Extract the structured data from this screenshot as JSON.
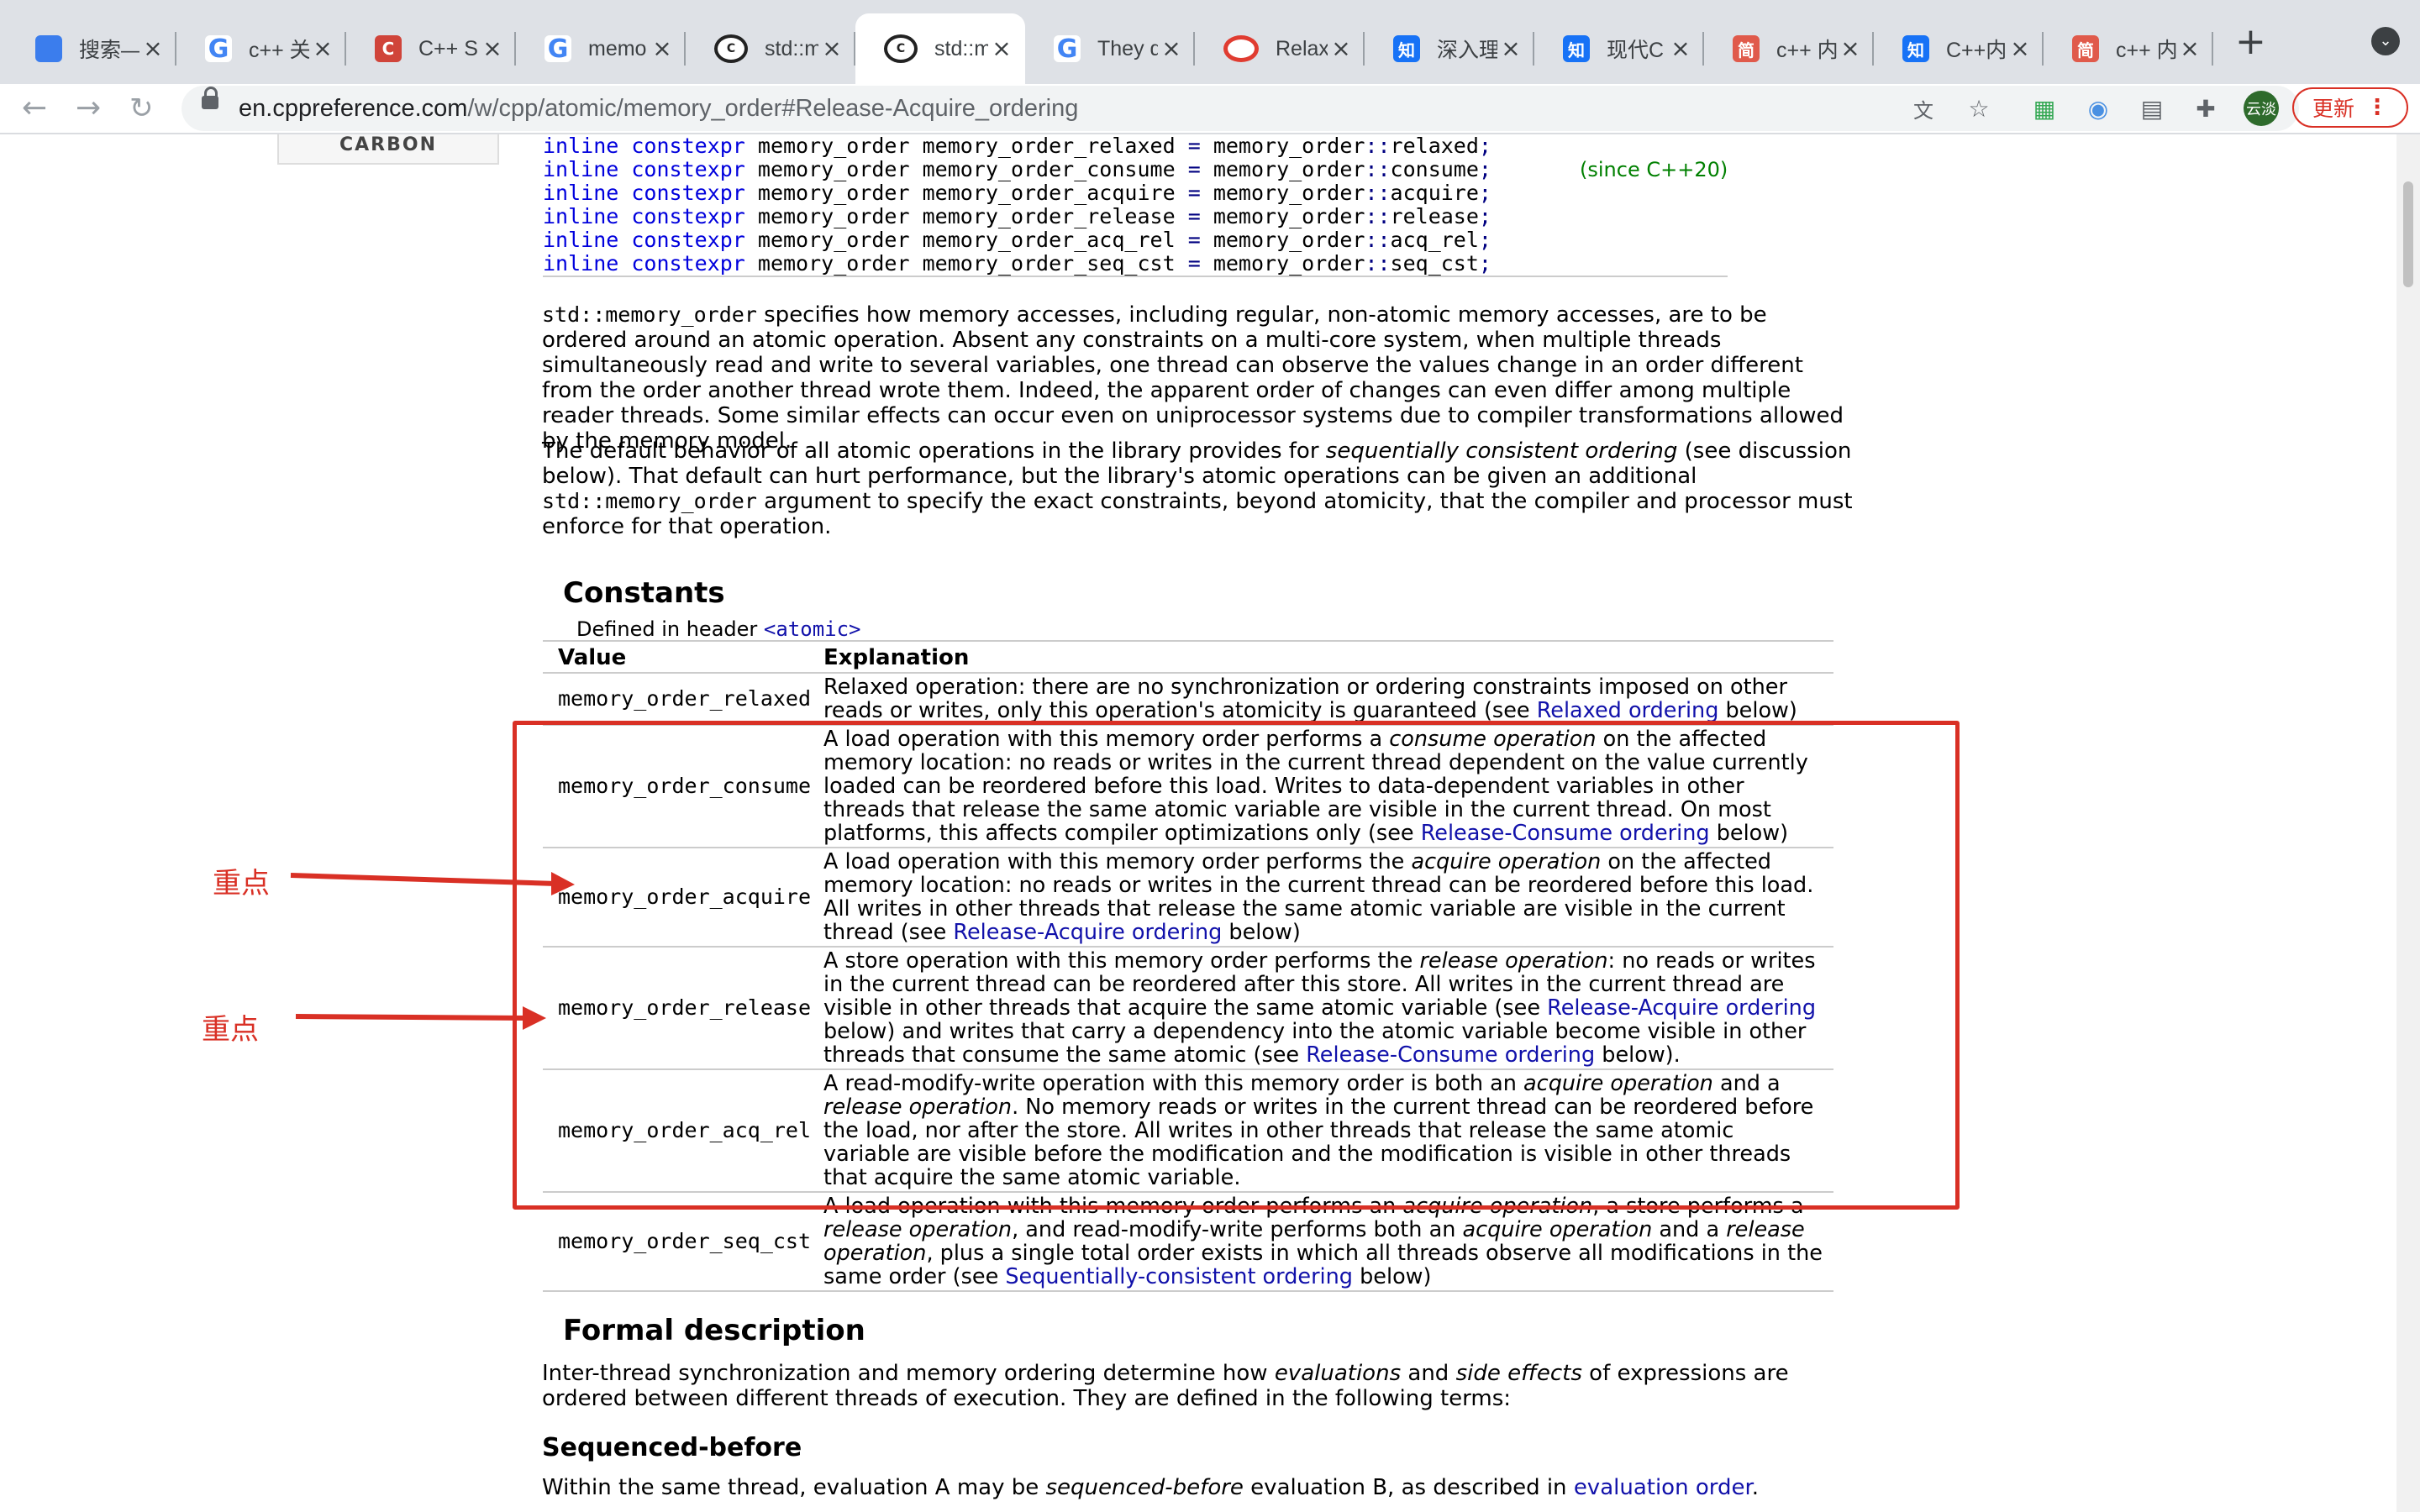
{
  "tabs": [
    {
      "icon": "doc-blue-icon",
      "glyph": "",
      "fav": "fav-blue",
      "title": "搜索—"
    },
    {
      "icon": "google-icon",
      "glyph": "G",
      "fav": "fav-google",
      "title": "c++ 关"
    },
    {
      "icon": "c-red-icon",
      "glyph": "C",
      "fav": "fav-red",
      "title": "C++ S"
    },
    {
      "icon": "google-icon",
      "glyph": "G",
      "fav": "fav-google",
      "title": "memo"
    },
    {
      "icon": "cppreference-icon",
      "glyph": "C",
      "fav": "fav-cpp",
      "title": "std::m"
    },
    {
      "icon": "cppreference-icon",
      "glyph": "C",
      "fav": "fav-cpp",
      "title": "std::m",
      "active": true
    },
    {
      "icon": "google-icon",
      "glyph": "G",
      "fav": "fav-google",
      "title": "They d"
    },
    {
      "icon": "opera-icon",
      "glyph": "",
      "fav": "fav-opera",
      "title": "Relaxe"
    },
    {
      "icon": "zhihu-icon",
      "glyph": "知",
      "fav": "fav-zhihu",
      "title": "深入理"
    },
    {
      "icon": "zhihu-icon",
      "glyph": "知",
      "fav": "fav-zhihu",
      "title": "现代C"
    },
    {
      "icon": "jianshu-icon",
      "glyph": "简",
      "fav": "fav-jian",
      "title": "c++ 内"
    },
    {
      "icon": "zhihu-icon",
      "glyph": "知",
      "fav": "fav-zhihu",
      "title": "C++内"
    },
    {
      "icon": "jianshu-icon",
      "glyph": "简",
      "fav": "fav-jian",
      "title": "c++ 内"
    }
  ],
  "toolbar": {
    "url_host": "en.cppreference.com",
    "url_path": "/w/cpp/atomic/memory_order#Release-Acquire_ordering",
    "avatar_label": "云淡",
    "update_label": "更新",
    "new_tab_label": "+"
  },
  "page": {
    "carbon_label": "CARBON",
    "declarations": [
      {
        "kw1": "inline",
        "kw2": "constexpr",
        "type": "memory_order",
        "name": "memory_order_relaxed",
        "eq": "=",
        "scope": "memory_order",
        "sep": "::",
        "member": "relaxed",
        "end": ";"
      },
      {
        "kw1": "inline",
        "kw2": "constexpr",
        "type": "memory_order",
        "name": "memory_order_consume",
        "eq": "=",
        "scope": "memory_order",
        "sep": "::",
        "member": "consume",
        "end": ";",
        "since": "(since C++20)"
      },
      {
        "kw1": "inline",
        "kw2": "constexpr",
        "type": "memory_order",
        "name": "memory_order_acquire",
        "eq": "=",
        "scope": "memory_order",
        "sep": "::",
        "member": "acquire",
        "end": ";"
      },
      {
        "kw1": "inline",
        "kw2": "constexpr",
        "type": "memory_order",
        "name": "memory_order_release",
        "eq": "=",
        "scope": "memory_order",
        "sep": "::",
        "member": "release",
        "end": ";"
      },
      {
        "kw1": "inline",
        "kw2": "constexpr",
        "type": "memory_order",
        "name": "memory_order_acq_rel",
        "eq": "=",
        "scope": "memory_order",
        "sep": "::",
        "member": "acq_rel",
        "end": ";"
      },
      {
        "kw1": "inline",
        "kw2": "constexpr",
        "type": "memory_order",
        "name": "memory_order_seq_cst",
        "eq": "=",
        "scope": "memory_order",
        "sep": "::",
        "member": "seq_cst",
        "end": ";"
      }
    ],
    "intro1": {
      "code": "std::memory_order",
      "text": " specifies how memory accesses, including regular, non-atomic memory accesses, are to be ordered around an atomic operation. Absent any constraints on a multi-core system, when multiple threads simultaneously read and write to several variables, one thread can observe the values change in an order different from the order another thread wrote them. Indeed, the apparent order of changes can even differ among multiple reader threads. Some similar effects can occur even on uniprocessor systems due to compiler transformations allowed by the memory model."
    },
    "intro2": {
      "a": "The default behavior of all atomic operations in the library provides for ",
      "em": "sequentially consistent ordering",
      "b": " (see discussion below). That default can hurt performance, but the library's atomic operations can be given an additional ",
      "code": "std::memory_order",
      "c": " argument to specify the exact constraints, beyond atomicity, that the compiler and processor must enforce for that operation."
    },
    "constants_heading": "Constants",
    "defined_in": "Defined in header ",
    "defined_header": "<atomic>",
    "table_headers": {
      "value": "Value",
      "explanation": "Explanation"
    },
    "rows": [
      {
        "value": "memory_order_relaxed",
        "parts": [
          {
            "t": "Relaxed operation: there are no synchronization or ordering constraints imposed on other reads or writes, only this operation's atomicity is guaranteed (see "
          },
          {
            "t": "Relaxed ordering",
            "k": "link"
          },
          {
            "t": " below)"
          }
        ]
      },
      {
        "value": "memory_order_consume",
        "parts": [
          {
            "t": "A load operation with this memory order performs a "
          },
          {
            "t": "consume operation",
            "k": "em"
          },
          {
            "t": " on the affected memory location: no reads or writes in the current thread dependent on the value currently loaded can be reordered before this load. Writes to data-dependent variables in other threads that release the same atomic variable are visible in the current thread. On most platforms, this affects compiler optimizations only (see "
          },
          {
            "t": "Release-Consume ordering",
            "k": "link"
          },
          {
            "t": " below)"
          }
        ]
      },
      {
        "value": "memory_order_acquire",
        "parts": [
          {
            "t": "A load operation with this memory order performs the "
          },
          {
            "t": "acquire operation",
            "k": "em"
          },
          {
            "t": " on the affected memory location: no reads or writes in the current thread can be reordered before this load. All writes in other threads that release the same atomic variable are visible in the current thread (see "
          },
          {
            "t": "Release-Acquire ordering",
            "k": "link"
          },
          {
            "t": " below)"
          }
        ]
      },
      {
        "value": "memory_order_release",
        "parts": [
          {
            "t": "A store operation with this memory order performs the "
          },
          {
            "t": "release operation",
            "k": "em"
          },
          {
            "t": ": no reads or writes in the current thread can be reordered after this store. All writes in the current thread are visible in other threads that acquire the same atomic variable (see "
          },
          {
            "t": "Release-Acquire ordering",
            "k": "link"
          },
          {
            "t": " below) and writes that carry a dependency into the atomic variable become visible in other threads that consume the same atomic (see "
          },
          {
            "t": "Release-Consume ordering",
            "k": "link"
          },
          {
            "t": " below)."
          }
        ]
      },
      {
        "value": "memory_order_acq_rel",
        "parts": [
          {
            "t": "A read-modify-write operation with this memory order is both an "
          },
          {
            "t": "acquire operation",
            "k": "em"
          },
          {
            "t": " and a "
          },
          {
            "t": "release operation",
            "k": "em"
          },
          {
            "t": ". No memory reads or writes in the current thread can be reordered before the load, nor after the store. All writes in other threads that release the same atomic variable are visible before the modification and the modification is visible in other threads that acquire the same atomic variable."
          }
        ]
      },
      {
        "value": "memory_order_seq_cst",
        "parts": [
          {
            "t": "A load operation with this memory order performs an "
          },
          {
            "t": "acquire operation",
            "k": "em"
          },
          {
            "t": ", a store performs a "
          },
          {
            "t": "release operation",
            "k": "em"
          },
          {
            "t": ", and read-modify-write performs both an "
          },
          {
            "t": "acquire operation",
            "k": "em"
          },
          {
            "t": " and a "
          },
          {
            "t": "release operation",
            "k": "em"
          },
          {
            "t": ", plus a single total order exists in which all threads observe all modifications in the same order (see "
          },
          {
            "t": "Sequentially-consistent ordering",
            "k": "link"
          },
          {
            "t": " below)"
          }
        ]
      }
    ],
    "formal_heading": "Formal description",
    "formal_text": {
      "a": "Inter-thread synchronization and memory ordering determine how ",
      "em1": "evaluations",
      "b": " and ",
      "em2": "side effects",
      "c": " of expressions are ordered between different threads of execution. They are defined in the following terms:"
    },
    "sequenced_heading": "Sequenced-before",
    "sequenced_text": {
      "a": "Within the same thread, evaluation A may be ",
      "em": "sequenced-before",
      "b": " evaluation B, as described in ",
      "link": "evaluation order",
      "c": "."
    }
  },
  "annotations": {
    "note1": "重点",
    "note2": "重点",
    "color": "#d93025"
  }
}
